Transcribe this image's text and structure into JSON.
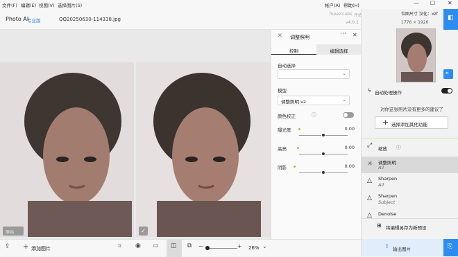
{
  "menu": [
    "文件(F)",
    "编辑(E)",
    "视图(V)",
    "选择图片(S)",
    "帐户(A)",
    "帮助(H)"
  ],
  "window_controls": {
    "minimize": "—",
    "maximize": "☐",
    "close": "✕"
  },
  "app": {
    "name": "Photo AI",
    "tier": "专业版",
    "filename": "QQ20250630-114338.jpg",
    "brand": "Topaz Labs",
    "trial_note": "· 评估许可证",
    "version": "v4.0.1"
  },
  "image_info": {
    "label": "位图尺寸 汉化：xzf",
    "size": "1776 × 1920"
  },
  "panel": {
    "title": "调整照明",
    "tabs": [
      "控制",
      "编辑选择"
    ],
    "auto_select_label": "自动选择",
    "auto_select_value": "",
    "model_label": "模型",
    "model_value": "调整照明 v2",
    "color_correct_label": "颜色校正",
    "color_correct_on": false,
    "sliders": [
      {
        "label": "曝光度",
        "value": "0.00",
        "level": 0.5
      },
      {
        "label": "高亮",
        "value": "0.00",
        "level": 0.5
      },
      {
        "label": "阴影",
        "value": "0.00",
        "level": 0.5
      }
    ]
  },
  "stage": {
    "before_label": "原始",
    "zoom": "26%"
  },
  "bottom": {
    "add_label": "添加图片"
  },
  "right": {
    "autopilot_label": "自动处理操作",
    "autopilot_on": true,
    "suggest_text": "对你这张照片没有更多的建议了",
    "add_more_label": "选择添加其他功能",
    "tools": [
      {
        "name": "缩放",
        "sub": "",
        "icon": "expand-icon"
      },
      {
        "name": "调整照明",
        "sub": "All",
        "icon": "sun-icon"
      },
      {
        "name": "Sharpen",
        "sub": "All",
        "icon": "triangle-icon"
      },
      {
        "name": "Sharpen",
        "sub": "Subject",
        "icon": "triangle-icon"
      },
      {
        "name": "Denoise",
        "sub": "",
        "icon": "triangle-icon"
      }
    ],
    "save_preset_label": "将编辑另存为新预设",
    "export_label": "输出图片"
  },
  "colors": {
    "accent": "#2d8cf0",
    "toggle_on": "#222222",
    "slider_dot": "#9bc23b"
  }
}
